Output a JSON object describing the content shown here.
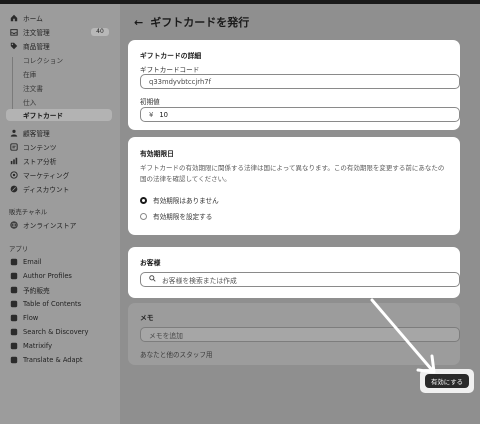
{
  "sidebar": {
    "items": [
      {
        "label": "ホーム",
        "icon": "home-icon"
      },
      {
        "label": "注文管理",
        "icon": "inbox-icon",
        "badge": "40"
      },
      {
        "label": "商品管理",
        "icon": "tag-icon"
      },
      {
        "label": "コレクション"
      },
      {
        "label": "在庫"
      },
      {
        "label": "注文書"
      },
      {
        "label": "仕入"
      },
      {
        "label": "ギフトカード"
      },
      {
        "label": "顧客管理",
        "icon": "person-icon"
      },
      {
        "label": "コンテンツ",
        "icon": "content-icon"
      },
      {
        "label": "ストア分析",
        "icon": "analytics-icon"
      },
      {
        "label": "マーケティング",
        "icon": "target-icon"
      },
      {
        "label": "ディスカウント",
        "icon": "discount-icon"
      }
    ],
    "sales_channels": {
      "heading": "販売チャネル",
      "items": [
        {
          "label": "オンラインストア",
          "icon": "store-icon"
        }
      ]
    },
    "apps": {
      "heading": "アプリ",
      "items": [
        {
          "label": "Email",
          "icon": "app-icon"
        },
        {
          "label": "Author Profiles",
          "icon": "app-icon"
        },
        {
          "label": "予約販売",
          "icon": "app-icon"
        },
        {
          "label": "Table of Contents",
          "icon": "app-icon"
        },
        {
          "label": "Flow",
          "icon": "app-icon"
        },
        {
          "label": "Search & Discovery",
          "icon": "app-icon"
        },
        {
          "label": "Matrixify",
          "icon": "app-icon"
        },
        {
          "label": "Translate & Adapt",
          "icon": "app-icon"
        }
      ]
    }
  },
  "page": {
    "title": "ギフトカードを発行"
  },
  "details": {
    "heading": "ギフトカードの詳細",
    "code_label": "ギフトカードコード",
    "code_value": "q33mdyvbtccjrh7f",
    "value_label": "初期値",
    "currency": "¥",
    "value": "10"
  },
  "expiry": {
    "heading": "有効期限日",
    "help": "ギフトカードの有効期限に関係する法律は国によって異なります。この有効期限を変更する前にあなたの国の法律を確認してください。",
    "options": [
      {
        "label": "有効期限はありません",
        "selected": true
      },
      {
        "label": "有効期限を設定する",
        "selected": false
      }
    ]
  },
  "customer": {
    "heading": "お客様",
    "search_placeholder": "お客様を検索または作成"
  },
  "memo": {
    "heading": "メモ",
    "placeholder": "メモを追加",
    "help": "あなたと他のスタッフ用"
  },
  "footer": {
    "activate_label": "有効にする"
  },
  "colors": {
    "accent": "#1a1a1a",
    "overlay": "#8f8f8f",
    "card": "#ffffff"
  }
}
